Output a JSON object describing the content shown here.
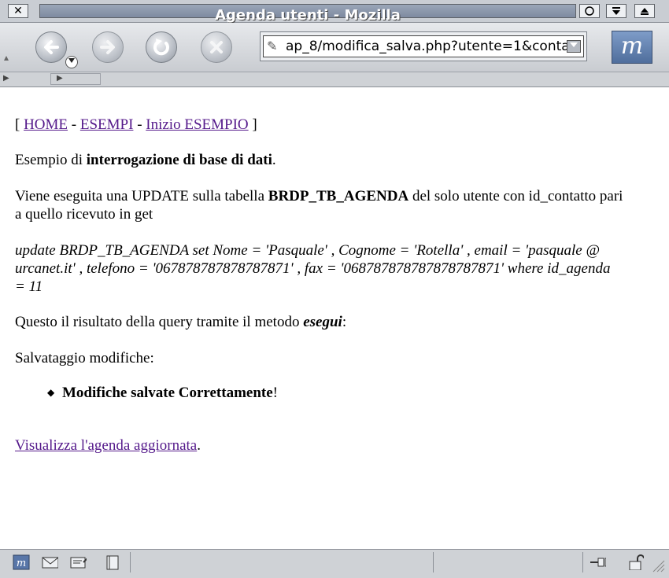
{
  "window": {
    "title": "Agenda utenti - Mozilla",
    "close_glyph": "✕"
  },
  "toolbar": {
    "url": "ap_8/modifica_salva.php?utente=1&conta",
    "logo": "m"
  },
  "page": {
    "nav_open": "[",
    "nav_home": "HOME",
    "nav_sep1": " - ",
    "nav_esempi": "ESEMPI",
    "nav_sep2": " - ",
    "nav_inizio": "Inizio ESEMPIO",
    "nav_close": " ]",
    "intro_pre": "Esempio di ",
    "intro_bold": "interrogazione di base di dati",
    "intro_post": ".",
    "desc_pre": "Viene eseguita una UPDATE sulla tabella ",
    "desc_bold": "BRDP_TB_AGENDA",
    "desc_post": " del solo utente con id_contatto pari a quello ricevuto in get",
    "query": "update BRDP_TB_AGENDA set Nome = 'Pasquale' , Cognome = 'Rotella' , email = 'pasquale @ urcanet.it' , telefono = '067878787878787871' , fax = '068787878787878787871' where id_agenda = 11",
    "result_pre": "Questo il risultato della query tramite il metodo ",
    "result_bold": "esegui",
    "result_post": ":",
    "save_label": "Salvataggio modifiche:",
    "bullet_bold": "Modifiche salvate Correttamente",
    "bullet_post": "!",
    "view_link": "Visualizza l'agenda aggiornata",
    "view_post": "."
  }
}
